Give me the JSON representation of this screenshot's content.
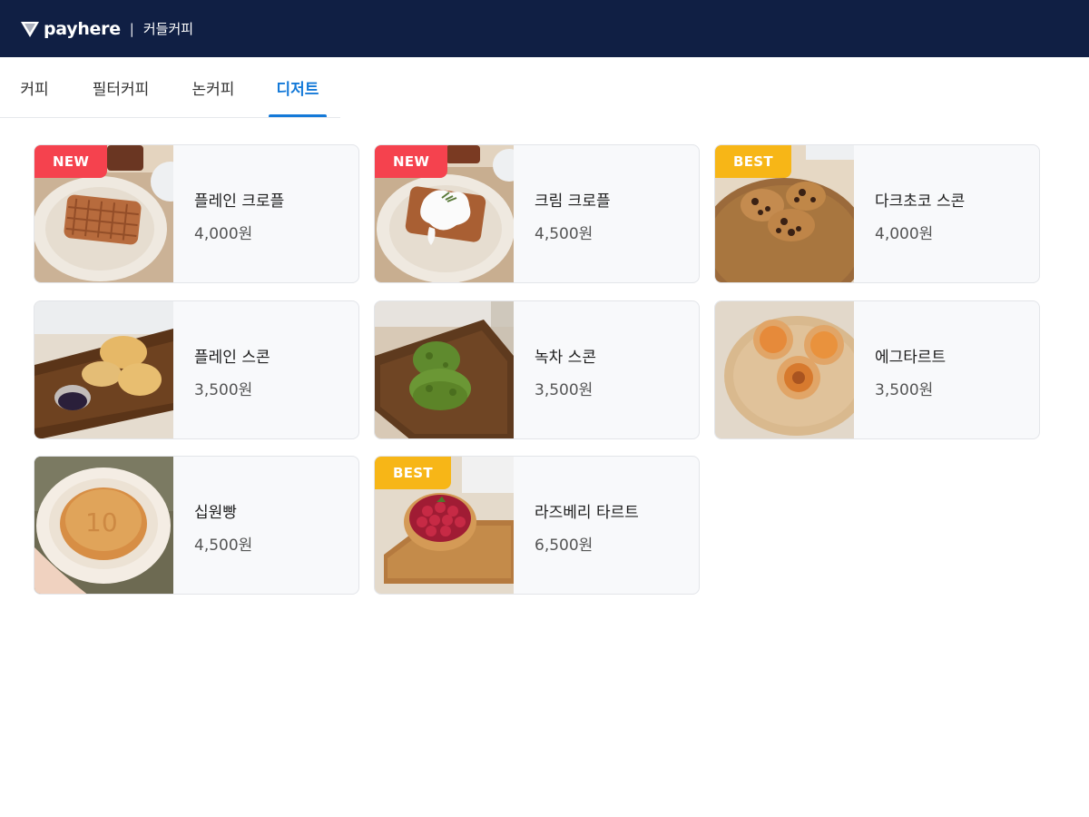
{
  "header": {
    "brand": "payhere",
    "separator": "|",
    "store_name": "커들커피"
  },
  "tabs": [
    {
      "label": "커피",
      "active": false
    },
    {
      "label": "필터커피",
      "active": false
    },
    {
      "label": "논커피",
      "active": false
    },
    {
      "label": "디저트",
      "active": true
    }
  ],
  "products": [
    {
      "name": "플레인 크로플",
      "price": "4,000원",
      "badge": "NEW"
    },
    {
      "name": "크림 크로플",
      "price": "4,500원",
      "badge": "NEW"
    },
    {
      "name": "다크초코 스콘",
      "price": "4,000원",
      "badge": "BEST"
    },
    {
      "name": "플레인 스콘",
      "price": "3,500원",
      "badge": ""
    },
    {
      "name": "녹차 스콘",
      "price": "3,500원",
      "badge": ""
    },
    {
      "name": "에그타르트",
      "price": "3,500원",
      "badge": ""
    },
    {
      "name": "십원빵",
      "price": "4,500원",
      "badge": ""
    },
    {
      "name": "라즈베리 타르트",
      "price": "6,500원",
      "badge": "BEST"
    }
  ],
  "colors": {
    "header_bg": "#101f44",
    "accent": "#1479d8",
    "badge_new": "#f5424e",
    "badge_best": "#f7b617"
  }
}
